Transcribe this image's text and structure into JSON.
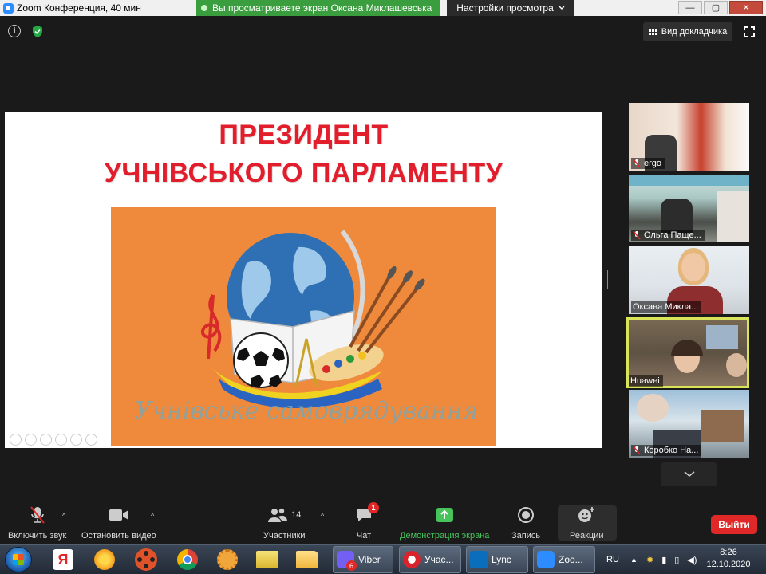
{
  "window": {
    "title": "Zoom Конференция, 40 мин",
    "share_banner": "Вы просматриваете экран Оксана Миклашевська",
    "view_options": "Настройки просмотра",
    "controls": {
      "minimize": "—",
      "maximize": "▢",
      "close": "✕"
    }
  },
  "topbar": {
    "info_icon": "i",
    "speaker_view": "Вид докладчика"
  },
  "slide": {
    "title_line1": "ПРЕЗИДЕНТ",
    "title_line2": "УЧНІВСЬКОГО ПАРЛАМЕНТУ",
    "image_caption": "Учнівське самоврядування",
    "colors": {
      "title": "#e21e2c",
      "image_bg": "#ef8a3c"
    }
  },
  "participants": [
    {
      "name": "ergo",
      "muted": true,
      "active": false
    },
    {
      "name": "Ольга Паще...",
      "muted": true,
      "active": false
    },
    {
      "name": "Оксана Микла...",
      "muted": false,
      "active": false
    },
    {
      "name": "Huawei",
      "muted": false,
      "active": true
    },
    {
      "name": "Коробко На...",
      "muted": true,
      "active": false
    }
  ],
  "toolbar": {
    "unmute": "Включить звук",
    "stop_video": "Остановить видео",
    "participants": "Участники",
    "participants_count": "14",
    "chat": "Чат",
    "chat_badge": "1",
    "share_screen": "Демонстрация экрана",
    "record": "Запись",
    "reactions": "Реакции",
    "leave": "Выйти"
  },
  "taskbar": {
    "apps": [
      "windows-start",
      "yandex",
      "sun-app",
      "media-player",
      "chrome",
      "settings-app",
      "files",
      "folder"
    ],
    "yandex_label": "Я",
    "tasks": [
      {
        "label": "Viber",
        "badge": "6",
        "color": "#7360f2"
      },
      {
        "label": "Учас...",
        "color": "#d9232d"
      },
      {
        "label": "Lync",
        "color": "#0a6ebd"
      },
      {
        "label": "Zoo...",
        "color": "#2d8cff"
      }
    ],
    "language": "RU",
    "time": "8:26",
    "date": "12.10.2020"
  }
}
